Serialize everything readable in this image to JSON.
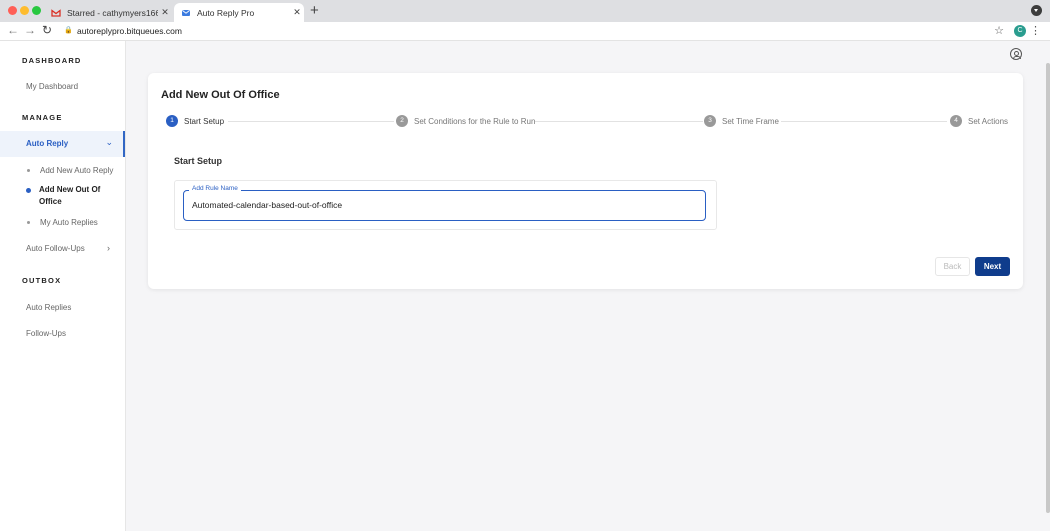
{
  "browser": {
    "tabs": [
      {
        "title": "Starred - cathymyers166@gm...",
        "close": "✕"
      },
      {
        "title": "Auto Reply Pro",
        "close": "✕"
      }
    ],
    "new_tab": "+",
    "url": "autoreplypro.bitqueues.com",
    "profile_initial": "C"
  },
  "sidebar": {
    "sections": [
      "DASHBOARD",
      "MANAGE",
      "OUTBOX"
    ],
    "dashboard_link": "My Dashboard",
    "auto_reply": "Auto Reply",
    "sub_items": [
      "Add New Auto Reply",
      "Add New Out Of Office",
      "My Auto Replies"
    ],
    "auto_followups": "Auto Follow-Ups",
    "outbox_links": [
      "Auto Replies",
      "Follow-Ups"
    ]
  },
  "card": {
    "title": "Add New Out Of Office",
    "steps": [
      {
        "num": "1",
        "label": "Start Setup"
      },
      {
        "num": "2",
        "label": "Set Conditions for the Rule to Run"
      },
      {
        "num": "3",
        "label": "Set Time Frame"
      },
      {
        "num": "4",
        "label": "Set Actions"
      }
    ],
    "section_title": "Start Setup",
    "field_label": "Add Rule Name",
    "field_value": "Automated-calendar-based-out-of-office",
    "back_label": "Back",
    "next_label": "Next"
  },
  "colors": {
    "accent": "#2a5fc3",
    "primary_button": "#0f3c8c"
  }
}
